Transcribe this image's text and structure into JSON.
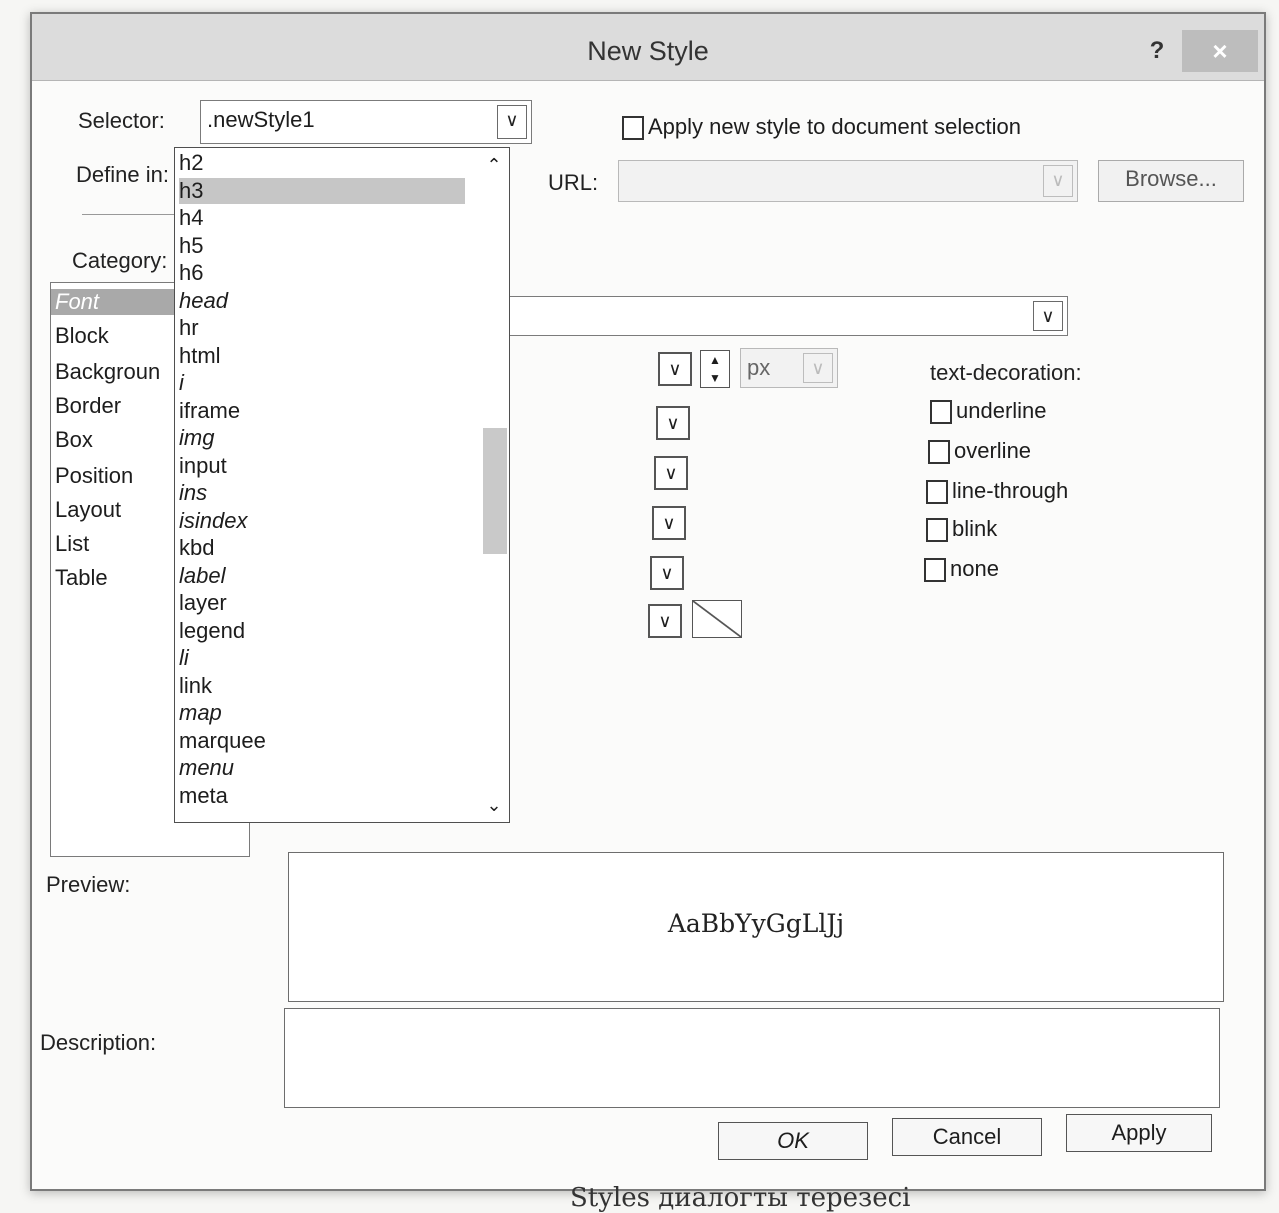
{
  "dialog": {
    "title": "New Style",
    "help": "?",
    "close": "×"
  },
  "selector": {
    "label": "Selector:",
    "value": ".newStyle1"
  },
  "define_in": {
    "label": "Define in:"
  },
  "apply_new_style": {
    "label": "Apply new style to document selection"
  },
  "url": {
    "label": "URL:",
    "browse_label": "Browse..."
  },
  "category": {
    "label": "Category:",
    "items": [
      "Font",
      "Block",
      "Backgroun",
      "Border",
      "Box",
      "Position",
      "Layout",
      "List",
      "Table"
    ],
    "selected": "Font"
  },
  "dropdown": {
    "items": [
      "h2",
      "h3",
      "h4",
      "h5",
      "h6",
      "head",
      "hr",
      "html",
      "i",
      "iframe",
      "img",
      "input",
      "ins",
      "isindex",
      "kbd",
      "label",
      "layer",
      "legend",
      "li",
      "link",
      "map",
      "marquee",
      "menu",
      "meta"
    ],
    "highlighted": "h3"
  },
  "font_panel": {
    "unit": "px",
    "text_decoration_label": "text-decoration:",
    "decorations": [
      "underline",
      "overline",
      "line-through",
      "blink",
      "none"
    ]
  },
  "preview": {
    "label": "Preview:",
    "sample": "AaBbYyGgLlJj"
  },
  "description": {
    "label": "Description:"
  },
  "buttons": {
    "ok": "OK",
    "cancel": "Cancel",
    "apply": "Apply"
  },
  "caption": "Styles диалогты терезесі"
}
